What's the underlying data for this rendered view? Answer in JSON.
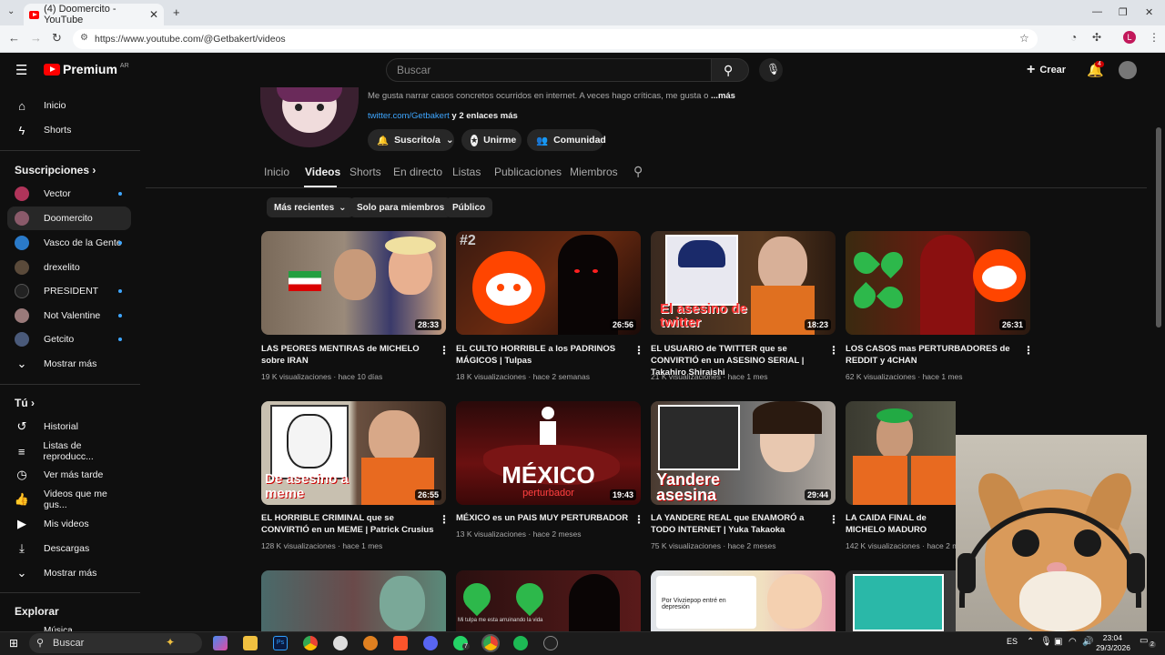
{
  "browser": {
    "tab_title": "(4) Doomercito - YouTube",
    "url": "https://www.youtube.com/@Getbakert/videos"
  },
  "header": {
    "logo_text": "Premium",
    "logo_region": "AR",
    "search_placeholder": "Buscar",
    "create_label": "Crear",
    "notifications_count": "4"
  },
  "sidebar": {
    "main": [
      {
        "label": "Inicio",
        "icon": "home-icon"
      },
      {
        "label": "Shorts",
        "icon": "shorts-icon"
      }
    ],
    "subscriptions_title": "Suscripciones",
    "subscriptions": [
      {
        "label": "Vector",
        "dot": true
      },
      {
        "label": "Doomercito",
        "dot": false,
        "active": true
      },
      {
        "label": "Vasco de la Gente",
        "dot": true
      },
      {
        "label": "drexelito",
        "dot": false
      },
      {
        "label": "PRESIDENT",
        "dot": true
      },
      {
        "label": "Not Valentine",
        "dot": true
      },
      {
        "label": "Getcito",
        "dot": true
      }
    ],
    "show_more": "Mostrar más",
    "you_title": "Tú",
    "you_items": [
      {
        "label": "Historial",
        "icon": "history-icon"
      },
      {
        "label": "Listas de reproducc...",
        "icon": "playlist-icon"
      },
      {
        "label": "Ver más tarde",
        "icon": "clock-icon"
      },
      {
        "label": "Videos que me gus...",
        "icon": "thumbs-up-icon"
      },
      {
        "label": "Mis videos",
        "icon": "play-square-icon"
      },
      {
        "label": "Descargas",
        "icon": "download-icon"
      }
    ],
    "show_more_2": "Mostrar más",
    "explore_title": "Explorar",
    "explore_partial": "Música"
  },
  "channel": {
    "description": "Me gusta narrar casos concretos ocurridos en internet. A veces hago críticas, me gusta o",
    "more": "...más",
    "link": "twitter.com/Getbakert",
    "extra_links": "y 2 enlaces más",
    "subscribed_label": "Suscrito/a",
    "join_label": "Unirme",
    "community_label": "Comunidad"
  },
  "tabs": [
    "Inicio",
    "Videos",
    "Shorts",
    "En directo",
    "Listas",
    "Publicaciones",
    "Miembros"
  ],
  "chips": [
    "Más recientes",
    "Solo para miembros",
    "Público"
  ],
  "videos": [
    {
      "title": "LAS PEORES MENTIRAS de MICHELO sobre IRAN",
      "duration": "28:33",
      "views": "19 K visualizaciones",
      "age": "hace 10 días"
    },
    {
      "title": "EL CULTO HORRIBLE a los PADRINOS MÁGICOS | Tulpas",
      "duration": "26:56",
      "views": "18 K visualizaciones",
      "age": "hace 2 semanas",
      "thumb_text": "#2"
    },
    {
      "title": "EL USUARIO de TWITTER que se CONVIRTIÓ en un ASESINO SERIAL | Takahiro Shiraishi",
      "duration": "18:23",
      "views": "21 K visualizaciones",
      "age": "hace 1 mes",
      "thumb_text": "El asesino de twitter"
    },
    {
      "title": "LOS CASOS mas PERTURBADORES de REDDIT y 4CHAN",
      "duration": "26:31",
      "views": "62 K visualizaciones",
      "age": "hace 1 mes"
    },
    {
      "title": "EL HORRIBLE CRIMINAL que se CONVIRTIÓ en un MEME | Patrick Crusius",
      "duration": "26:55",
      "views": "128 K visualizaciones",
      "age": "hace 1 mes",
      "thumb_text": "De asesino a meme"
    },
    {
      "title": "MÉXICO es un PAIS MUY PERTURBADOR",
      "duration": "19:43",
      "views": "13 K visualizaciones",
      "age": "hace 2 meses",
      "thumb_text": "MÉXICO",
      "thumb_sub": "perturbador"
    },
    {
      "title": "LA YANDERE REAL que ENAMORÓ a TODO INTERNET | Yuka Takaoka",
      "duration": "29:44",
      "views": "75 K visualizaciones",
      "age": "hace 2 meses",
      "thumb_text": "Yandere asesina"
    },
    {
      "title": "LA CAIDA FINAL de MICHELO MADURO",
      "duration": "",
      "views": "142 K visualizaciones",
      "age": "hace 2 m"
    }
  ],
  "row3_thumbs": [
    {
      "text": ""
    },
    {
      "text": "Mi tulpa me esta arruinando la vida"
    },
    {
      "text": "Por Vivziepop entré en depresión"
    },
    {
      "text": ""
    }
  ],
  "taskbar": {
    "search_label": "Buscar",
    "language": "ES",
    "time": "23:04",
    "date": "29/3/2026",
    "notif_count": "2",
    "whatsapp_badge": "7"
  },
  "colors": {
    "background": "#0f0f0f",
    "accent_red": "#ff0000",
    "link_blue": "#3ea6ff",
    "chip_bg": "#272727"
  }
}
